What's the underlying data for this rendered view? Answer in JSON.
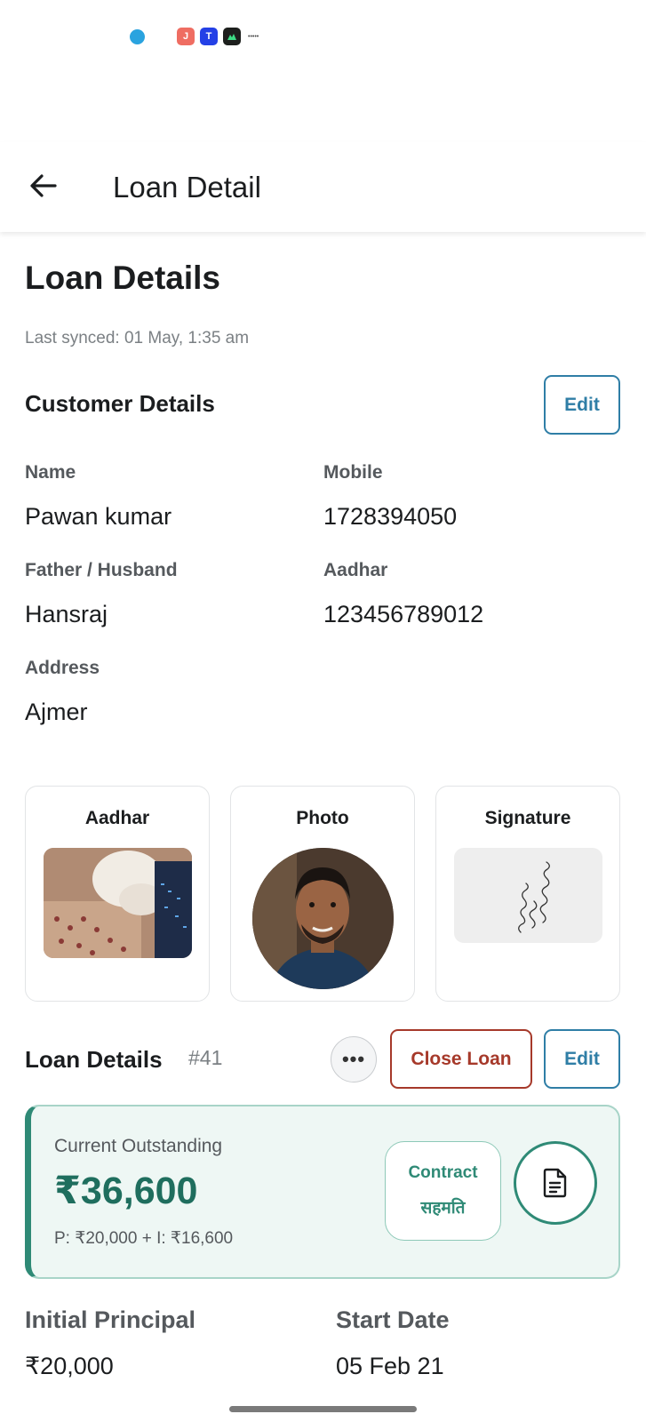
{
  "app_bar": {
    "title": "Loan Detail"
  },
  "header": {
    "title": "Loan Details",
    "last_synced": "Last synced: 01 May, 1:35 am"
  },
  "customer": {
    "section_title": "Customer Details",
    "edit_label": "Edit",
    "fields": {
      "name_label": "Name",
      "name_value": "Pawan kumar",
      "mobile_label": "Mobile",
      "mobile_value": "1728394050",
      "father_label": "Father / Husband",
      "father_value": "Hansraj",
      "aadhar_label": "Aadhar",
      "aadhar_value": "123456789012",
      "address_label": "Address",
      "address_value": "Ajmer"
    }
  },
  "documents": [
    {
      "title": "Aadhar"
    },
    {
      "title": "Photo"
    },
    {
      "title": "Signature"
    }
  ],
  "loan": {
    "section_title": "Loan Details",
    "id": "#41",
    "more_label": "•••",
    "close_label": "Close Loan",
    "edit_label": "Edit",
    "outstanding_label": "Current Outstanding",
    "outstanding_amount": "₹36,600",
    "breakdown": "P: ₹20,000 + I: ₹16,600",
    "contract_en": "Contract",
    "contract_hi": "सहमति",
    "initial_principal_label": "Initial Principal",
    "initial_principal_value": "₹20,000",
    "start_date_label": "Start Date",
    "start_date_value": "05 Feb 21"
  },
  "icons": {
    "back": "arrow-left-icon",
    "document": "document-icon",
    "more": "more-horizontal-icon"
  },
  "colors": {
    "accent_blue": "#2f7ea6",
    "danger_red": "#a6392a",
    "teal": "#2f8a76",
    "teal_bg": "#eef7f4"
  }
}
